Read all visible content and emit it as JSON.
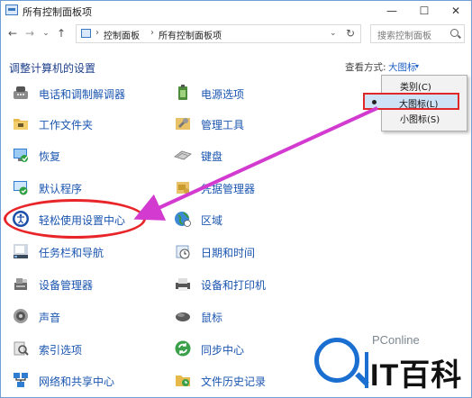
{
  "window": {
    "title": "所有控制面板项",
    "minimize_glyph": "—",
    "maximize_glyph": "☐",
    "close_glyph": "✕"
  },
  "nav": {
    "back": "←",
    "forward": "→",
    "recent": "⌄",
    "up": "↑"
  },
  "address": {
    "crumbs": [
      "控制面板",
      "所有控制面板项"
    ],
    "separator": "›",
    "dropdown": "⌄",
    "refresh": "↻"
  },
  "search": {
    "placeholder": "搜索控制面板"
  },
  "header": {
    "heading": "调整计算机的设置",
    "view_by_label": "查看方式:",
    "view_by_value": "大图标",
    "view_arrow": "▾"
  },
  "view_menu": {
    "options": [
      "类别(C)",
      "大图标(L)",
      "小图标(S)"
    ],
    "selected": "大图标(L)"
  },
  "items_left": [
    {
      "label": "电话和调制解调器",
      "icon": "phone-modem-icon"
    },
    {
      "label": "工作文件夹",
      "icon": "work-folders-icon"
    },
    {
      "label": "恢复",
      "icon": "recovery-icon"
    },
    {
      "label": "默认程序",
      "icon": "default-programs-icon"
    },
    {
      "label": "轻松使用设置中心",
      "icon": "ease-of-access-icon"
    },
    {
      "label": "任务栏和导航",
      "icon": "taskbar-icon"
    },
    {
      "label": "设备管理器",
      "icon": "device-manager-icon"
    },
    {
      "label": "声音",
      "icon": "sound-icon"
    },
    {
      "label": "索引选项",
      "icon": "indexing-options-icon"
    },
    {
      "label": "网络和共享中心",
      "icon": "network-sharing-icon"
    }
  ],
  "items_right": [
    {
      "label": "电源选项",
      "icon": "power-options-icon"
    },
    {
      "label": "管理工具",
      "icon": "admin-tools-icon"
    },
    {
      "label": "键盘",
      "icon": "keyboard-icon"
    },
    {
      "label": "凭据管理器",
      "icon": "credential-manager-icon"
    },
    {
      "label": "区域",
      "icon": "region-icon"
    },
    {
      "label": "日期和时间",
      "icon": "date-time-icon"
    },
    {
      "label": "设备和打印机",
      "icon": "devices-printers-icon"
    },
    {
      "label": "鼠标",
      "icon": "mouse-icon"
    },
    {
      "label": "同步中心",
      "icon": "sync-center-icon"
    },
    {
      "label": "文件历史记录",
      "icon": "file-history-icon"
    }
  ],
  "watermark": {
    "brand": "PConline",
    "text": "IT百科"
  },
  "colors": {
    "accent": "#1a55b0",
    "highlight": "#e8262a",
    "arrow": "#d23ad0"
  }
}
